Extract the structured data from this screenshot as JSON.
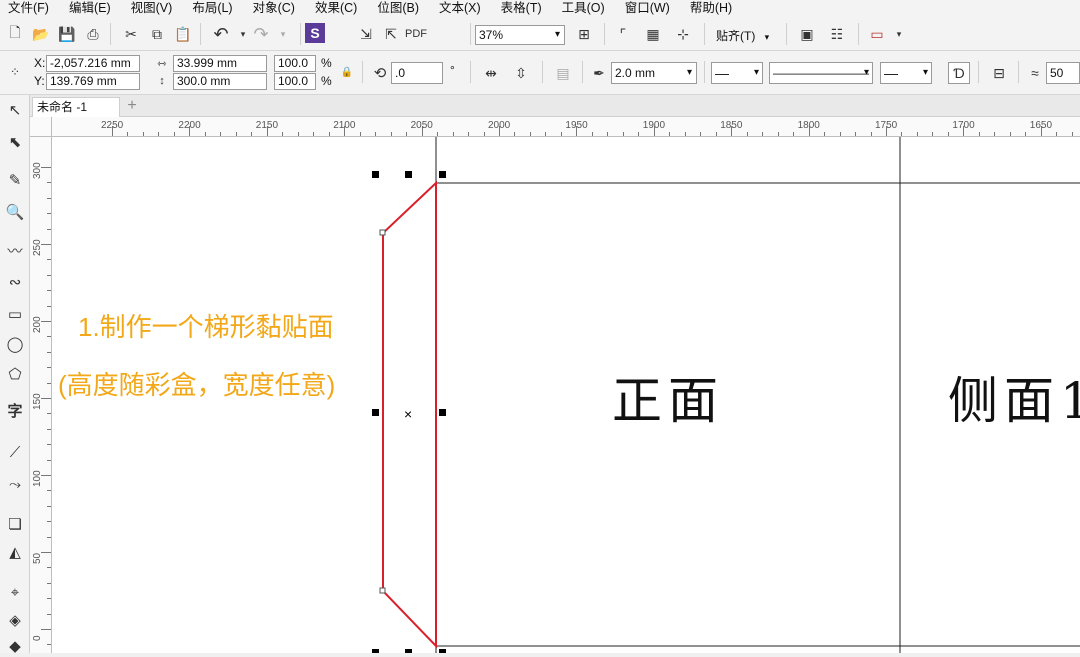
{
  "menu": [
    "文件(F)",
    "编辑(E)",
    "视图(V)",
    "布局(L)",
    "对象(C)",
    "效果(C)",
    "位图(B)",
    "文本(X)",
    "表格(T)",
    "工具(O)",
    "窗口(W)",
    "帮助(H)"
  ],
  "toolbar1": {
    "zoom": "37%",
    "snap_label": "贴齐(T)"
  },
  "props": {
    "x_label": "X:",
    "y_label": "Y:",
    "x_value": "-2,057.216 mm",
    "y_value": "139.769 mm",
    "w_value": "33.999 mm",
    "h_value": "300.0 mm",
    "scale_w": "100.0",
    "scale_h": "100.0",
    "pct": "%",
    "rotation": ".0",
    "degree": "°",
    "outline_width": "2.0 mm",
    "outline_style": "————————",
    "right_value": "50"
  },
  "document": {
    "tab_name": "未命名 -1",
    "tab_add": "+"
  },
  "ruler": {
    "h_labels": [
      "2250",
      "2200",
      "2150",
      "2100",
      "2050",
      "2000",
      "1950",
      "1900",
      "1850",
      "1800",
      "1750",
      "1700",
      "1650"
    ],
    "v_labels": [
      "300",
      "250",
      "200",
      "150",
      "100",
      "50",
      "0"
    ]
  },
  "canvas": {
    "annotation_line1": "1.制作一个梯形黏贴面",
    "annotation_line2": "(高度随彩盒，宽度任意)",
    "front_text": "正面",
    "side_text": "侧面1",
    "trapezoid_color": "#d9202a",
    "annotation_color": "#f2a818"
  }
}
